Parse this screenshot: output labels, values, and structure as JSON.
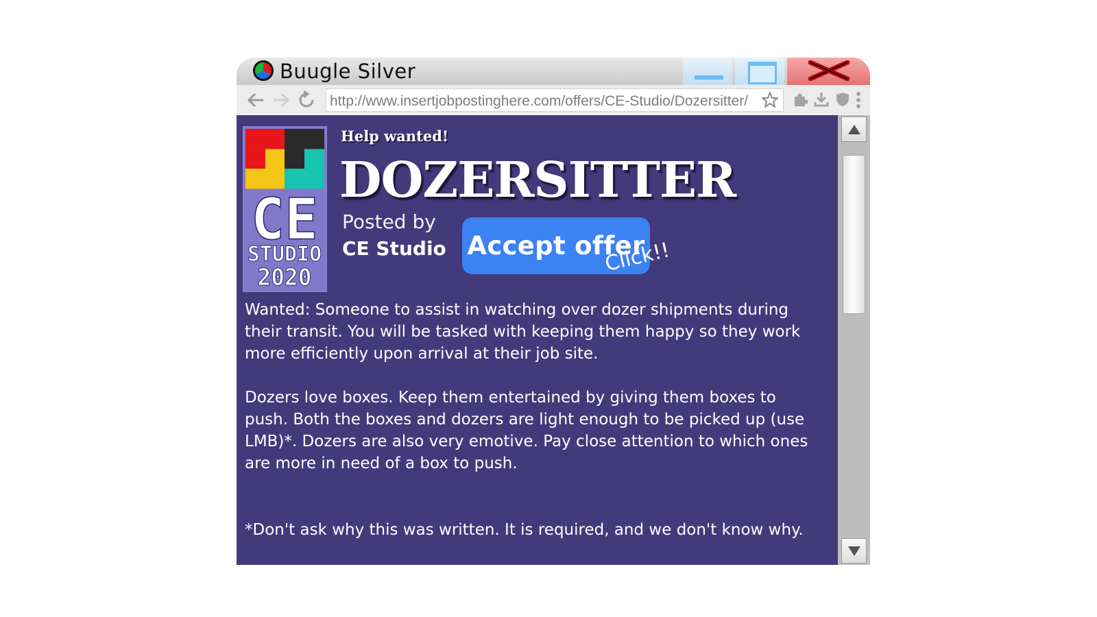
{
  "window": {
    "title": "Buugle Silver",
    "url": "http://www.insertjobpostinghere.com/offers/CE-Studio/Dozersitter/"
  },
  "icons": {
    "app": "browser-logo-icon",
    "back": "back-arrow-icon",
    "forward": "forward-arrow-icon",
    "reload": "reload-icon",
    "bookmark": "star-icon",
    "extensions": "puzzle-icon",
    "download": "download-icon",
    "shield": "shield-icon",
    "menu": "kebab-menu-icon",
    "minimize": "minimize-icon",
    "maximize": "maximize-icon",
    "close": "close-x-icon"
  },
  "posting": {
    "eyebrow": "Help wanted!",
    "title": "DOZERSITTER",
    "posted_by_label": "Posted by",
    "poster": "CE Studio",
    "accept_label": "Accept offer",
    "click_hint": "Click!!",
    "logo": {
      "letters": "CE",
      "studio": "STUDIO",
      "year": "2020"
    },
    "paragraphs": [
      "Wanted: Someone to assist in watching over dozer shipments during their transit. You will be tasked with keeping them happy so they work more efficiently upon arrival at their job site.",
      "Dozers love boxes. Keep them entertained by giving them boxes to push. Both the boxes and dozers are light enough to be picked up (use LMB)*. Dozers are also very emotive. Pay close attention to which ones are more in need of a box to push.",
      "*Don't ask why this was written. It is required, and we don't know why."
    ]
  },
  "colors": {
    "page_bg": "#433a7c",
    "accept_button": "#3b82f2",
    "close_button": "#e47373",
    "logo_red": "#e8161a",
    "logo_black": "#2a2a2a",
    "logo_yellow": "#f5c518",
    "logo_teal": "#17c4b0",
    "logo_purple": "#8277c9"
  }
}
